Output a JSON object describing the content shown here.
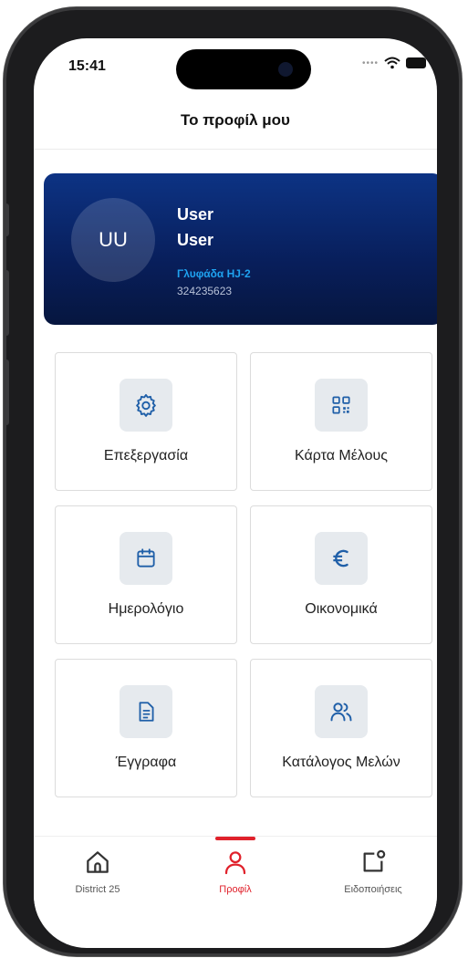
{
  "status_bar": {
    "time": "15:41"
  },
  "header": {
    "title": "Το προφίλ μου"
  },
  "profile": {
    "initials": "UU",
    "first_name": "User",
    "last_name": "User",
    "club": "Γλυφάδα HJ-2",
    "member_number": "324235623"
  },
  "tiles": [
    {
      "label": "Επεξεργασία",
      "icon": "gear-icon"
    },
    {
      "label": "Κάρτα Μέλους",
      "icon": "qr-code-icon"
    },
    {
      "label": "Ημερολόγιο",
      "icon": "calendar-icon"
    },
    {
      "label": "Οικονομικά",
      "icon": "euro-icon"
    },
    {
      "label": "Έγγραφα",
      "icon": "document-icon"
    },
    {
      "label": "Κατάλογος Μελών",
      "icon": "users-icon"
    }
  ],
  "tabs": [
    {
      "label": "District 25",
      "icon": "home-icon"
    },
    {
      "label": "Προφίλ",
      "icon": "user-icon",
      "active": true
    },
    {
      "label": "Ειδοποιήσεις",
      "icon": "notification-icon"
    }
  ],
  "colors": {
    "accent": "#e0212b",
    "icon_blue": "#1f5fa8",
    "card_top": "#0d3384",
    "card_bottom": "#06163f",
    "club_text": "#1fa2f0"
  }
}
